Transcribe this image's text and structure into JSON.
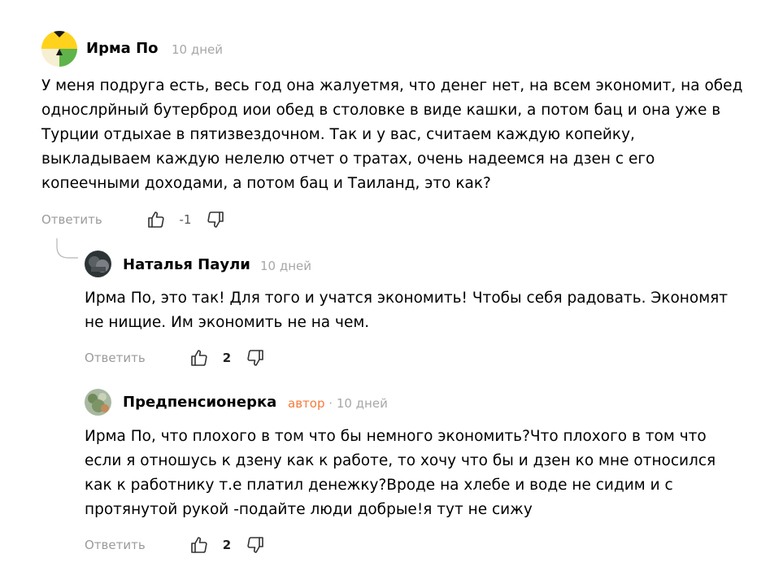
{
  "comments": [
    {
      "author": "Ирма По",
      "time": "10 дней",
      "text": "У меня подруга есть, весь год она жалуетмя, что денег нет, на всем экономит, на обед\nоднослрйный бутерброд иои обед в столовке в виде кашки, а потом бац и она уже в\nТурции отдыхае в пятизвездочном. Так и у вас, считаем каждую копейку,\nвыкладываем каждую нелелю отчет о тратах, очень надеемся на дзен с его\nкопеечными доходами, а потом бац и Таиланд, это как?",
      "reply_label": "Ответить",
      "score": "-1",
      "avatar_icon": "yandex-zen-logo-avatar"
    },
    {
      "author": "Наталья Паули",
      "time": "10 дней",
      "text": "Ирма По, это так! Для того и учатся экономить! Чтобы себя радовать. Экономят\nне нищие. Им экономить не на чем.",
      "reply_label": "Ответить",
      "score": "2",
      "avatar_icon": "user-photo-avatar"
    },
    {
      "author": "Предпенсионерка",
      "badge": "автор",
      "separator": "·",
      "time": "10 дней",
      "text": "Ирма По, что плохого в том что бы немного экономить?Что плохого в том что\nесли я отношусь к дзену как к работе, то хочу что бы и дзен ко мне относился\nкак к работнику т.е платил денежку?Вроде на хлебе и воде не сидим и с\nпротянутой рукой -подайте люди добрые!я тут не сижу",
      "reply_label": "Ответить",
      "score": "2",
      "avatar_icon": "author-photo-avatar"
    }
  ],
  "colors": {
    "meta": "#a7a7a7",
    "badge": "#f57b3a",
    "action": "#9b9b9b"
  }
}
